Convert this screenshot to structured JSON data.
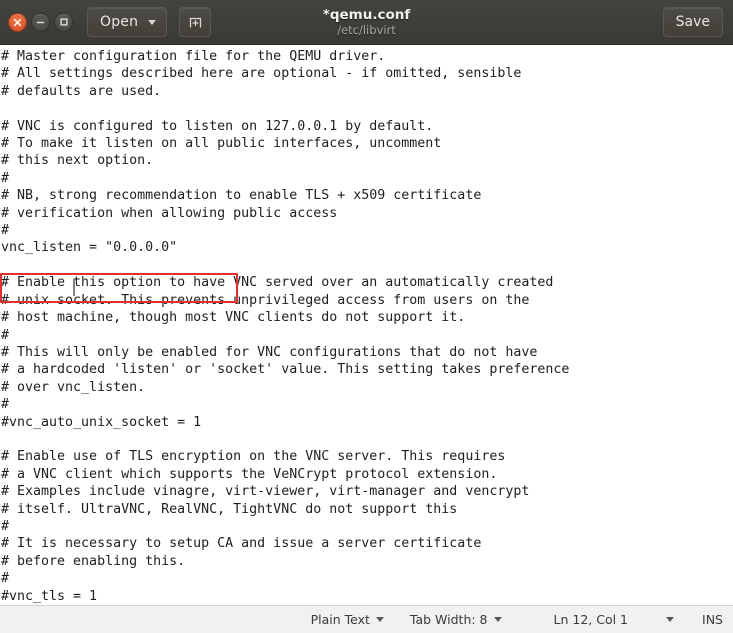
{
  "window": {
    "title": "*qemu.conf",
    "subtitle": "/etc/libvirt",
    "controls": {
      "close_label": "close-window",
      "minimize_label": "minimize-window",
      "maximize_label": "maximize-window"
    }
  },
  "toolbar": {
    "open_label": "Open",
    "new_document_label": "New Document",
    "save_label": "Save"
  },
  "editor": {
    "language": "Plain Text",
    "content": "# Master configuration file for the QEMU driver.\n# All settings described here are optional - if omitted, sensible\n# defaults are used.\n\n# VNC is configured to listen on 127.0.0.1 by default.\n# To make it listen on all public interfaces, uncomment\n# this next option.\n#\n# NB, strong recommendation to enable TLS + x509 certificate\n# verification when allowing public access\n#\nvnc_listen = \"0.0.0.0\"\n\n# Enable this option to have VNC served over an automatically created\n# unix socket. This prevents unprivileged access from users on the\n# host machine, though most VNC clients do not support it.\n#\n# This will only be enabled for VNC configurations that do not have\n# a hardcoded 'listen' or 'socket' value. This setting takes preference\n# over vnc_listen.\n#\n#vnc_auto_unix_socket = 1\n\n# Enable use of TLS encryption on the VNC server. This requires\n# a VNC client which supports the VeNCrypt protocol extension.\n# Examples include vinagre, virt-viewer, virt-manager and vencrypt\n# itself. UltraVNC, RealVNC, TightVNC do not support this\n#\n# It is necessary to setup CA and issue a server certificate\n# before enabling this.\n#\n#vnc_tls = 1",
    "highlighted_line": "vnc_listen = \"0.0.0.0\"",
    "highlight_color": "#e03030"
  },
  "statusbar": {
    "language": "Plain Text",
    "tab_width": "Tab Width: 8",
    "position": "Ln 12, Col 1",
    "insert_mode": "INS"
  }
}
